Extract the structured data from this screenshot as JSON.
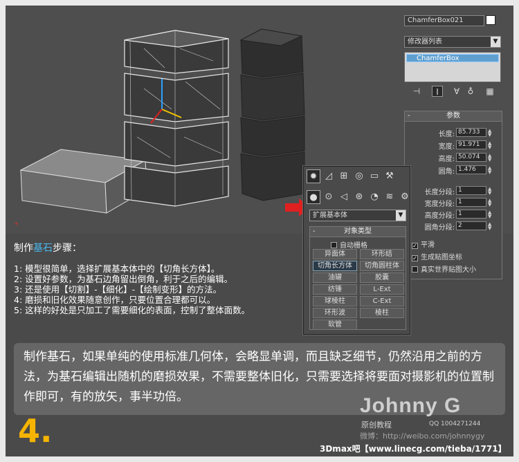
{
  "viewport": {
    "name": "3d-viewport"
  },
  "right_panel": {
    "object_name": "ChamferBox021",
    "modifier_list": "修改器列表",
    "stack_item": "ChamferBox",
    "params_title": "参数",
    "params": [
      {
        "label": "长度:",
        "value": "85.733"
      },
      {
        "label": "宽度:",
        "value": "91.971"
      },
      {
        "label": "高度:",
        "value": "50.074"
      },
      {
        "label": "圆角:",
        "value": "1.476"
      }
    ],
    "segments": [
      {
        "label": "长度分段:",
        "value": "1"
      },
      {
        "label": "宽度分段:",
        "value": "1"
      },
      {
        "label": "高度分段:",
        "value": "1"
      },
      {
        "label": "圆角分段:",
        "value": "2"
      }
    ],
    "checks": [
      {
        "label": "平滑",
        "checked": true
      },
      {
        "label": "生成贴图坐标",
        "checked": true
      },
      {
        "label": "真实世界贴图大小",
        "checked": false
      }
    ]
  },
  "create_panel": {
    "dropdown": "扩展基本体",
    "object_type_title": "对象类型",
    "auto_grid": "自动栅格",
    "buttons": [
      "异面体",
      "环形结",
      "切角长方体",
      "切角圆柱体",
      "油罐",
      "胶囊",
      "纺锤",
      "L-Ext",
      "球棱柱",
      "C-Ext",
      "环形波",
      "棱柱",
      "软管"
    ],
    "selected_button": "切角长方体"
  },
  "text": {
    "steps_title_prefix": "制作",
    "steps_title_highlight": "基石",
    "steps_title_suffix": "步骤：",
    "steps": [
      "1: 模型很简单，选择扩展基本体中的【切角长方体】。",
      "2: 设置好参数，为基石边角留出倒角，利于之后的编辑。",
      "3: 还是使用【切割】-【细化】-【绘制变形】的方法。",
      "4: 磨损和旧化效果随意创作，只要位置合理都可以。",
      "5: 这样的好处是只加工了需要细化的表面，控制了整体面数。"
    ],
    "caption": "制作基石，如果单纯的使用标准几何体，会略显单调，而且缺乏细节，仍然沿用之前的方法，为基石编辑出随机的磨损效果，不需要整体旧化，只需要选择将要面对摄影机的位置制作即可，有的放矢，事半功倍。",
    "step_number": "4.",
    "brand": "Johnny G",
    "brand_sub": "原创教程",
    "qq": "QQ 1004271244",
    "weibo": "微博：http://weibo.com/johnnygy",
    "footer": "3Dmax吧【www.linecg.com/tieba/1771】"
  },
  "colors": {
    "accent_red": "#e02020",
    "highlight_blue": "#49b8f0",
    "step_number": "#f6b400"
  }
}
